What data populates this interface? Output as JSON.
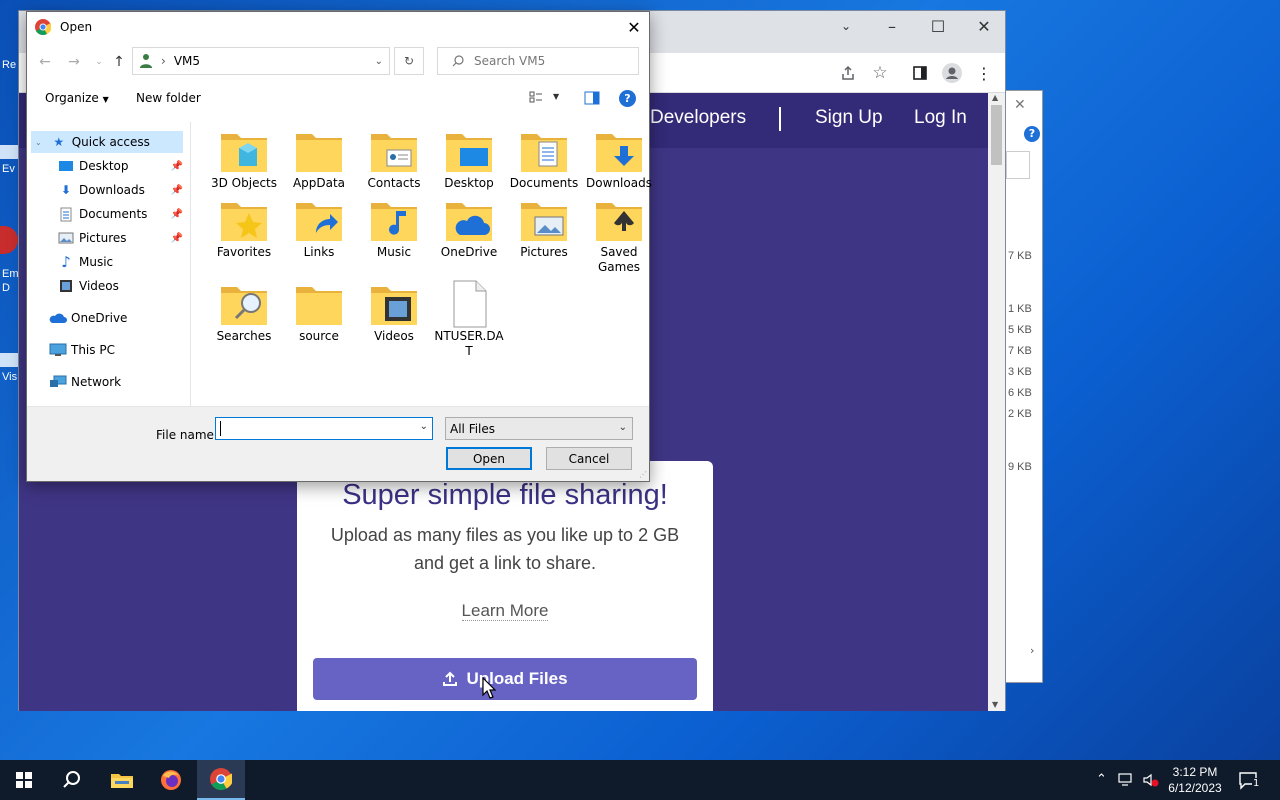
{
  "desktop": {
    "icon_labels": [
      "Re",
      "Ev",
      "Em\nD",
      "Vis"
    ]
  },
  "browser": {
    "nav": {
      "developers": "Developers",
      "signup": "Sign Up",
      "login": "Log In"
    },
    "card": {
      "title": "Super simple file sharing!",
      "subtitle": "Upload as many files as you like up to 2 GB and get a link to share.",
      "learn_more": "Learn More",
      "upload_button": "Upload Files"
    },
    "colors": {
      "site_bg": "#3f3585",
      "nav_bg": "#332a78",
      "upload_button": "#6763c5"
    }
  },
  "background_window": {
    "sizes": [
      "7 KB",
      "1 KB",
      "5 KB",
      "7 KB",
      "3 KB",
      "6 KB",
      "2 KB",
      "9 KB"
    ]
  },
  "dialog": {
    "title": "Open",
    "address": {
      "path_separator": "›",
      "location": "VM5"
    },
    "search_placeholder": "Search VM5",
    "toolbar": {
      "organize": "Organize",
      "new_folder": "New folder"
    },
    "nav_pane": {
      "quick_access": "Quick access",
      "items": [
        {
          "label": "Desktop",
          "icon": "desktop-icon",
          "pinned": true
        },
        {
          "label": "Downloads",
          "icon": "download-icon",
          "pinned": true
        },
        {
          "label": "Documents",
          "icon": "document-icon",
          "pinned": true
        },
        {
          "label": "Pictures",
          "icon": "picture-icon",
          "pinned": true
        },
        {
          "label": "Music",
          "icon": "music-icon",
          "pinned": false
        },
        {
          "label": "Videos",
          "icon": "video-icon",
          "pinned": false
        }
      ],
      "onedrive": "OneDrive",
      "this_pc": "This PC",
      "network": "Network"
    },
    "files": [
      {
        "name": "3D Objects",
        "icon": "folder-3d-icon"
      },
      {
        "name": "AppData",
        "icon": "folder-icon"
      },
      {
        "name": "Contacts",
        "icon": "folder-contacts-icon"
      },
      {
        "name": "Desktop",
        "icon": "folder-desktop-icon"
      },
      {
        "name": "Documents",
        "icon": "folder-documents-icon"
      },
      {
        "name": "Downloads",
        "icon": "folder-downloads-icon"
      },
      {
        "name": "Favorites",
        "icon": "folder-favorites-icon"
      },
      {
        "name": "Links",
        "icon": "folder-links-icon"
      },
      {
        "name": "Music",
        "icon": "folder-music-icon"
      },
      {
        "name": "OneDrive",
        "icon": "folder-onedrive-icon"
      },
      {
        "name": "Pictures",
        "icon": "folder-pictures-icon"
      },
      {
        "name": "Saved Games",
        "icon": "folder-saved-games-icon"
      },
      {
        "name": "Searches",
        "icon": "folder-searches-icon"
      },
      {
        "name": "source",
        "icon": "folder-icon"
      },
      {
        "name": "Videos",
        "icon": "folder-videos-icon"
      },
      {
        "name": "NTUSER.DAT",
        "icon": "file-icon"
      }
    ],
    "file_name_label": "File name:",
    "file_name_value": "",
    "file_type": "All Files",
    "open_button": "Open",
    "cancel_button": "Cancel"
  },
  "taskbar": {
    "time": "3:12 PM",
    "date": "6/12/2023",
    "notification_count": "1"
  }
}
